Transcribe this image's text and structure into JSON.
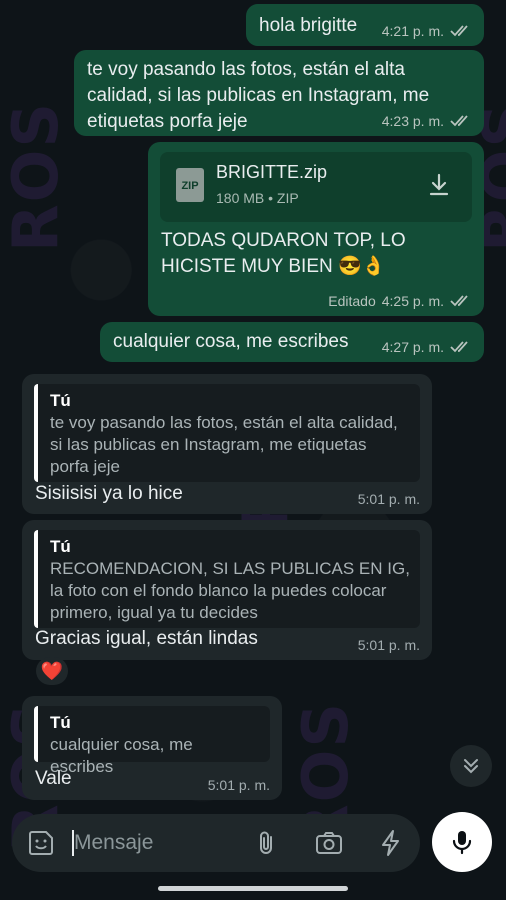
{
  "chat": {
    "outgoing": [
      {
        "text": "hola brigitte",
        "time": "4:21 p. m."
      },
      {
        "text": "te voy pasando las fotos, están el alta calidad, si las publicas en Instagram, me etiquetas porfa jeje",
        "time": "4:23 p. m."
      },
      {
        "file_name": "BRIGITTE.zip",
        "file_meta": "180 MB • ZIP",
        "file_badge": "ZIP",
        "text": "TODAS QUDARON TOP, LO HICISTE MUY BIEN 😎👌",
        "edited": "Editado",
        "time": "4:25 p. m."
      },
      {
        "text": "cualquier cosa, me escribes",
        "time": "4:27 p. m."
      }
    ],
    "incoming": [
      {
        "quote_author": "Tú",
        "quote_text": "te voy pasando las fotos, están el alta calidad, si las publicas en Instagram, me etiquetas porfa jeje",
        "text": "Sisiisisi ya lo hice",
        "time": "5:01 p. m."
      },
      {
        "quote_author": "Tú",
        "quote_text": "RECOMENDACION, SI LAS PUBLICAS EN IG, la foto con el fondo blanco la puedes colocar primero, igual ya tu decides",
        "text": "Gracias igual, están lindas",
        "time": "5:01 p. m."
      },
      {
        "quote_author": "Tú",
        "quote_text": "cualquier cosa, me escribes",
        "text": "Vale",
        "time": "5:01 p. m."
      }
    ],
    "reaction": "❤️"
  },
  "composer": {
    "placeholder": "Mensaje"
  },
  "icons": {
    "ticks": "double-check-icon",
    "download": "download-icon",
    "scroll": "double-chevron-down-icon",
    "sticker": "sticker-icon",
    "attach": "paperclip-icon",
    "camera": "camera-icon",
    "bolt": "lightning-icon",
    "mic": "microphone-icon"
  },
  "colors": {
    "outgoing_bubble": "#134d37",
    "incoming_bubble": "#1f272a",
    "tick_color": "#b9c4bf"
  }
}
